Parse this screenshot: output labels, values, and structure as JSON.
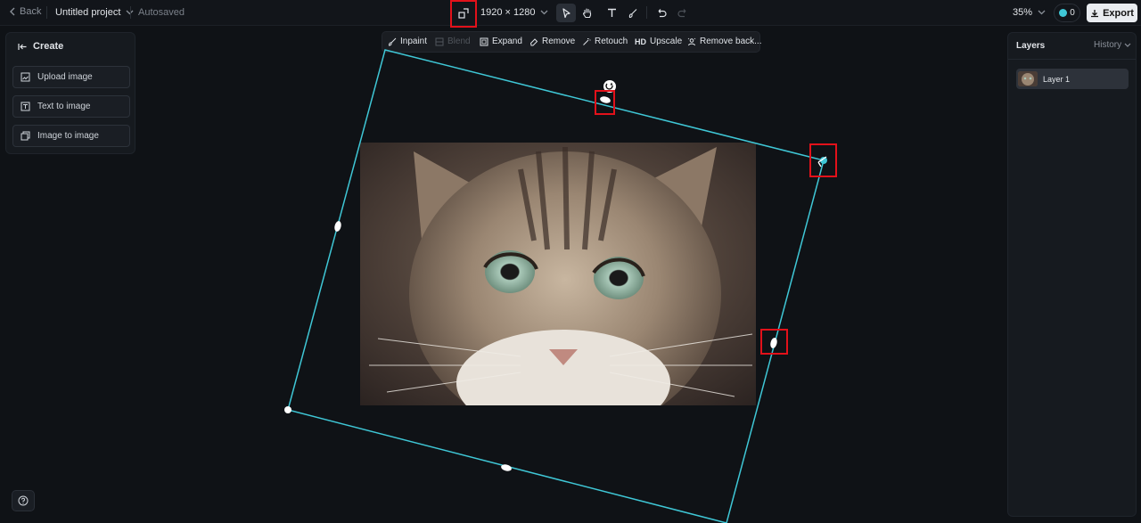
{
  "topbar": {
    "back_label": "Back",
    "project_name": "Untitled project",
    "autosave_status": "Autosaved",
    "dimensions": "1920 × 1280",
    "zoom": "35%",
    "credits": "0",
    "export_label": "Export"
  },
  "left_panel": {
    "title": "Create",
    "items": [
      {
        "label": "Upload image",
        "icon": "upload-image-icon"
      },
      {
        "label": "Text to image",
        "icon": "text-to-image-icon"
      },
      {
        "label": "Image to image",
        "icon": "image-to-image-icon"
      }
    ]
  },
  "edit_toolbar": {
    "items": [
      {
        "label": "Inpaint",
        "icon": "brush-icon",
        "enabled": true
      },
      {
        "label": "Blend",
        "icon": "blend-icon",
        "enabled": false
      },
      {
        "label": "Expand",
        "icon": "expand-icon",
        "enabled": true
      },
      {
        "label": "Remove",
        "icon": "eraser-icon",
        "enabled": true
      },
      {
        "label": "Retouch",
        "icon": "wand-icon",
        "enabled": true
      },
      {
        "label": "Upscale",
        "icon": "hd-icon",
        "enabled": true
      },
      {
        "label": "Remove back...",
        "icon": "remove-background-icon",
        "enabled": true
      }
    ]
  },
  "right_panel": {
    "title": "Layers",
    "history_label": "History",
    "layers": [
      {
        "label": "Layer 1",
        "selected": true
      }
    ]
  },
  "colors": {
    "accent": "#3fc7d6",
    "highlight": "#e2111a",
    "background": "#0f1216"
  }
}
